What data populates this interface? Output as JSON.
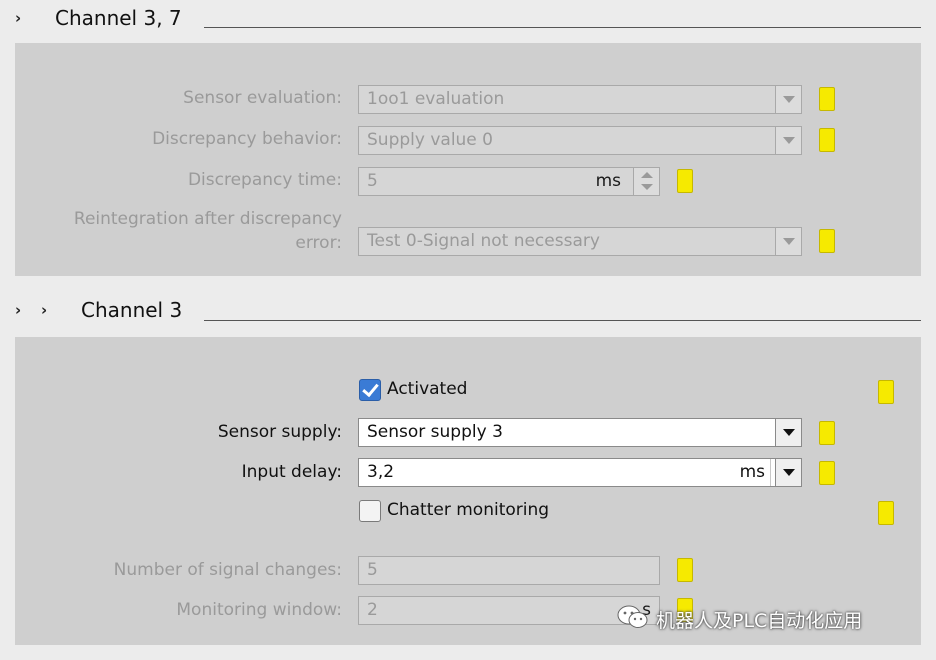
{
  "section1": {
    "title": "Channel 3, 7",
    "rows": {
      "sensor_eval": {
        "label": "Sensor evaluation:",
        "value": "1oo1 evaluation"
      },
      "disc_behavior": {
        "label": "Discrepancy behavior:",
        "value": "Supply value 0"
      },
      "disc_time": {
        "label": "Discrepancy time:",
        "value": "5",
        "unit": "ms"
      },
      "reintegration": {
        "label_line1": "Reintegration after discrepancy",
        "label_line2": "error:",
        "value": "Test 0-Signal not necessary"
      }
    }
  },
  "section2": {
    "title": "Channel 3",
    "activated": {
      "label": "Activated",
      "checked": true
    },
    "sensor_supply": {
      "label": "Sensor supply:",
      "value": "Sensor supply 3"
    },
    "input_delay": {
      "label": "Input delay:",
      "value": "3,2",
      "unit": "ms"
    },
    "chatter": {
      "label": "Chatter monitoring",
      "checked": false
    },
    "signal_changes": {
      "label": "Number of signal changes:",
      "value": "5"
    },
    "monitor_window": {
      "label": "Monitoring window:",
      "value": "2",
      "unit": "s"
    }
  },
  "watermark": "机器人及PLC自动化应用",
  "colors": {
    "panel": "#cfcfcf",
    "doc_marker": "#f6ea00",
    "checkbox_on": "#3a7bd5"
  },
  "icons": [
    "chevron-right-icon",
    "dropdown-arrow-icon",
    "spin-arrows-icon",
    "documentation-marker-icon",
    "checkbox-icon",
    "wechat-icon"
  ]
}
